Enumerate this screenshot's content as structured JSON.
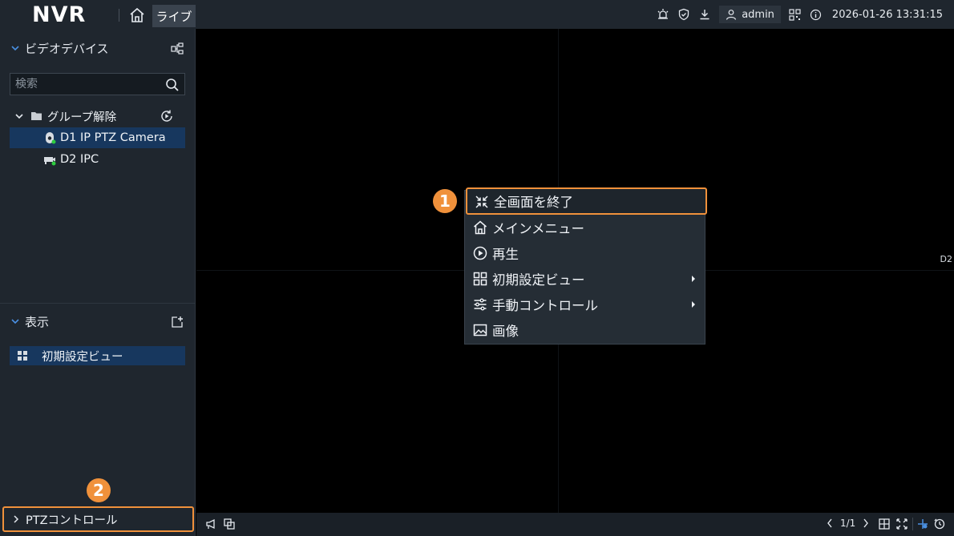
{
  "app": {
    "brand": "NVR",
    "active_tab": "ライブ",
    "user": "admin",
    "datetime": "2026-01-26 13:31:15"
  },
  "sidebar": {
    "devices_title": "ビデオデバイス",
    "search_placeholder": "検索",
    "group_label": "グループ解除",
    "devices": [
      {
        "label": "D1 IP PTZ Camera",
        "selected": true,
        "icon": "ptz-camera-icon"
      },
      {
        "label": "D2 IPC",
        "selected": false,
        "icon": "ipc-camera-icon"
      }
    ],
    "view_title": "表示",
    "views": [
      {
        "label": "初期設定ビュー",
        "selected": true
      }
    ],
    "ptz_label": "PTZコントロール"
  },
  "video": {
    "channel_label": "D2"
  },
  "bottombar": {
    "page": "1/1"
  },
  "context_menu": {
    "items": [
      {
        "label": "全画面を終了",
        "icon": "exit-fullscreen-icon",
        "submenu": false,
        "highlighted": true
      },
      {
        "label": "メインメニュー",
        "icon": "home-icon",
        "submenu": false
      },
      {
        "label": "再生",
        "icon": "play-circle-icon",
        "submenu": false
      },
      {
        "label": "初期設定ビュー",
        "icon": "grid-view-icon",
        "submenu": true
      },
      {
        "label": "手動コントロール",
        "icon": "sliders-icon",
        "submenu": true
      },
      {
        "label": "画像",
        "icon": "image-icon",
        "submenu": false
      }
    ]
  },
  "annotations": {
    "callout_1": "1",
    "callout_2": "2"
  },
  "colors": {
    "accent_orange": "#f0913b",
    "selection_blue": "#17375e",
    "panel_bg": "#1f262e"
  }
}
